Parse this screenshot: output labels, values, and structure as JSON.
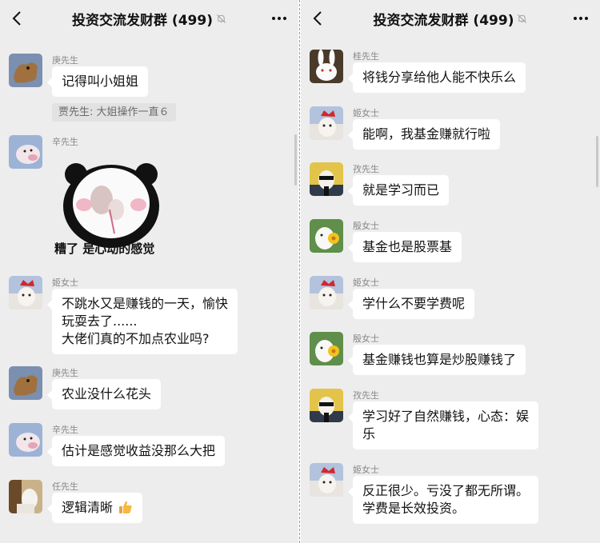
{
  "left": {
    "header": {
      "title": "投资交流发财群 (499)"
    },
    "messages": [
      {
        "sender": "庚先生",
        "lines": [
          "记得叫小姐姐"
        ],
        "quote": "贾先生: 大姐操作一直６"
      },
      {
        "sender": "辛先生",
        "sticker_caption": "糟了 是心动的感觉"
      },
      {
        "sender": "姬女士",
        "lines": [
          "不跳水又是赚钱的一天，愉快",
          "玩耍去了......",
          "大佬们真的不加点农业吗?"
        ]
      },
      {
        "sender": "庚先生",
        "lines": [
          "农业没什么花头"
        ]
      },
      {
        "sender": "辛先生",
        "lines": [
          "估计是感觉收益没那么大把"
        ]
      },
      {
        "sender": "任先生",
        "lines": [
          "逻辑清晰"
        ],
        "emoji": "thumbs-up-icon"
      }
    ]
  },
  "right": {
    "header": {
      "title": "投资交流发财群 (499)"
    },
    "messages": [
      {
        "sender": "桂先生",
        "lines": [
          "将钱分享给他人能不快乐么"
        ]
      },
      {
        "sender": "姬女士",
        "lines": [
          "能啊，我基金赚就行啦"
        ]
      },
      {
        "sender": "孜先生",
        "lines": [
          "就是学习而已"
        ]
      },
      {
        "sender": "殷女士",
        "lines": [
          "基金也是股票基"
        ]
      },
      {
        "sender": "姬女士",
        "lines": [
          "学什么不要学费呢"
        ]
      },
      {
        "sender": "殷女士",
        "lines": [
          "基金赚钱也算是炒股赚钱了"
        ]
      },
      {
        "sender": "孜先生",
        "lines": [
          "学习好了自然赚钱，心态：娱",
          "乐"
        ]
      },
      {
        "sender": "姬女士",
        "lines": [
          "反正很少。亏没了都无所谓。",
          "学费是长效投资。"
        ]
      }
    ]
  }
}
